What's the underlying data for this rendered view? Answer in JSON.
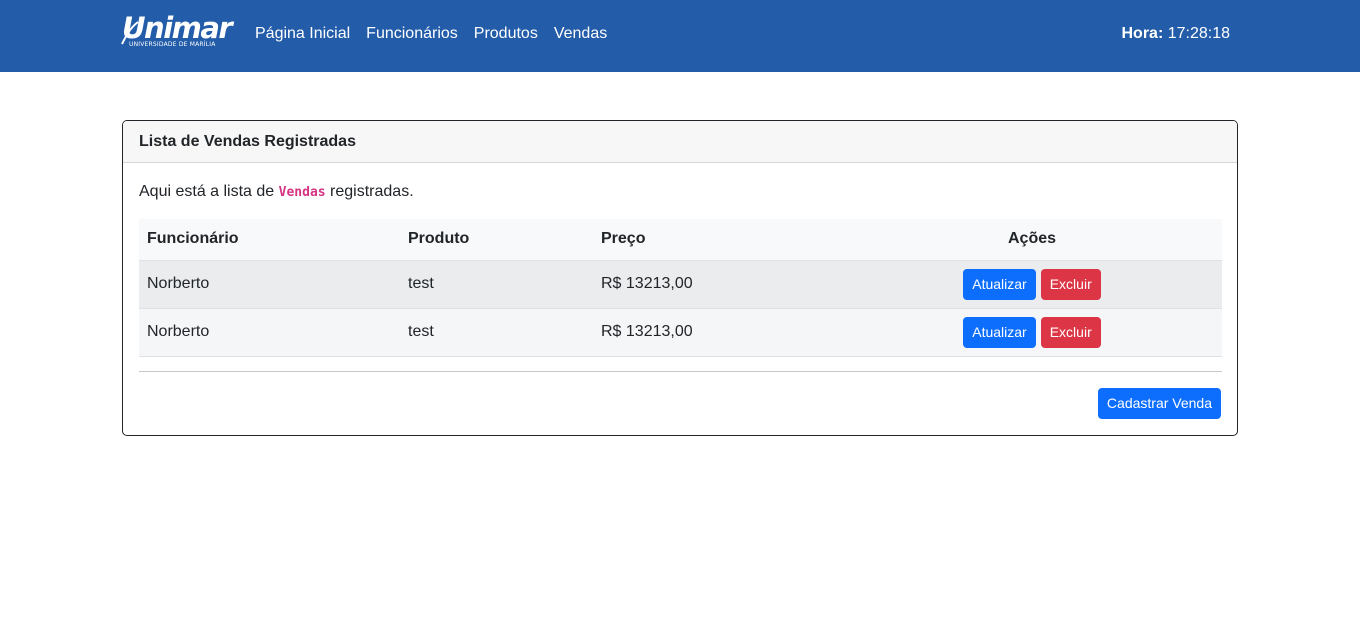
{
  "navbar": {
    "brand": {
      "name": "Unimar",
      "subtitle": "UNIVERSIDADE DE MARÍLIA"
    },
    "links": [
      "Página Inicial",
      "Funcionários",
      "Produtos",
      "Vendas"
    ],
    "clock_label": "Hora:",
    "clock_value": "17:28:18"
  },
  "card": {
    "header": "Lista de Vendas Registradas",
    "intro_prefix": "Aqui está a lista de ",
    "intro_code": "Vendas",
    "intro_suffix": " registradas.",
    "table": {
      "columns": [
        "Funcionário",
        "Produto",
        "Preço",
        "Ações"
      ],
      "rows": [
        {
          "funcionario": "Norberto",
          "produto": "test",
          "preco": "R$ 13213,00"
        },
        {
          "funcionario": "Norberto",
          "produto": "test",
          "preco": "R$ 13213,00"
        }
      ],
      "update_label": "Atualizar",
      "delete_label": "Excluir"
    },
    "submit_label": "Cadastrar Venda"
  },
  "colors": {
    "navbar": "#235ca8",
    "primary": "#0d6efd",
    "danger": "#dc3545",
    "code": "#d63384"
  }
}
